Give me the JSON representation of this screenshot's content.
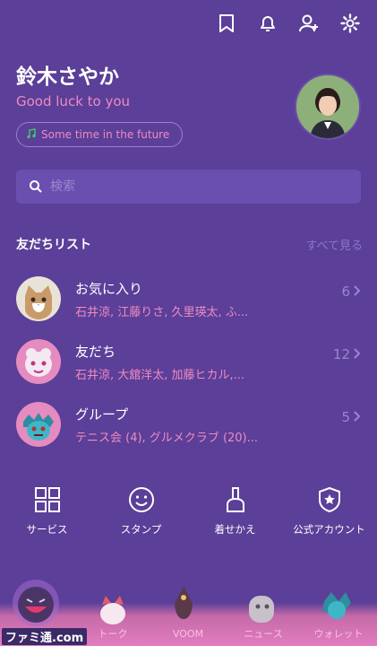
{
  "profile": {
    "name": "鈴木さやか",
    "status_message": "Good luck to you",
    "music": "Some time in the future"
  },
  "search": {
    "placeholder": "検索"
  },
  "friends_section": {
    "title": "友だちリスト",
    "see_all": "すべて見る",
    "rows": [
      {
        "title": "お気に入り",
        "subtitle": "石井涼, 江藤りさ, 久里瑛太, ふ...",
        "count": "6"
      },
      {
        "title": "友だち",
        "subtitle": "石井涼, 大舘洋太, 加藤ヒカル,...",
        "count": "12"
      },
      {
        "title": "グループ",
        "subtitle": "テニス会 (4), グルメクラブ (20)...",
        "count": "5"
      }
    ]
  },
  "services": [
    {
      "label": "サービス",
      "icon": "grid-icon"
    },
    {
      "label": "スタンプ",
      "icon": "smile-icon"
    },
    {
      "label": "着せかえ",
      "icon": "brush-icon"
    },
    {
      "label": "公式アカウント",
      "icon": "official-badge-icon"
    }
  ],
  "bottom_nav": [
    "",
    "トーク",
    "VOOM",
    "ニュース",
    "ウォレット"
  ],
  "watermark": "ファミ通.com",
  "colors": {
    "background": "#5b3f98",
    "accent_pink": "#f08bc0",
    "muted": "#9c86cf"
  }
}
